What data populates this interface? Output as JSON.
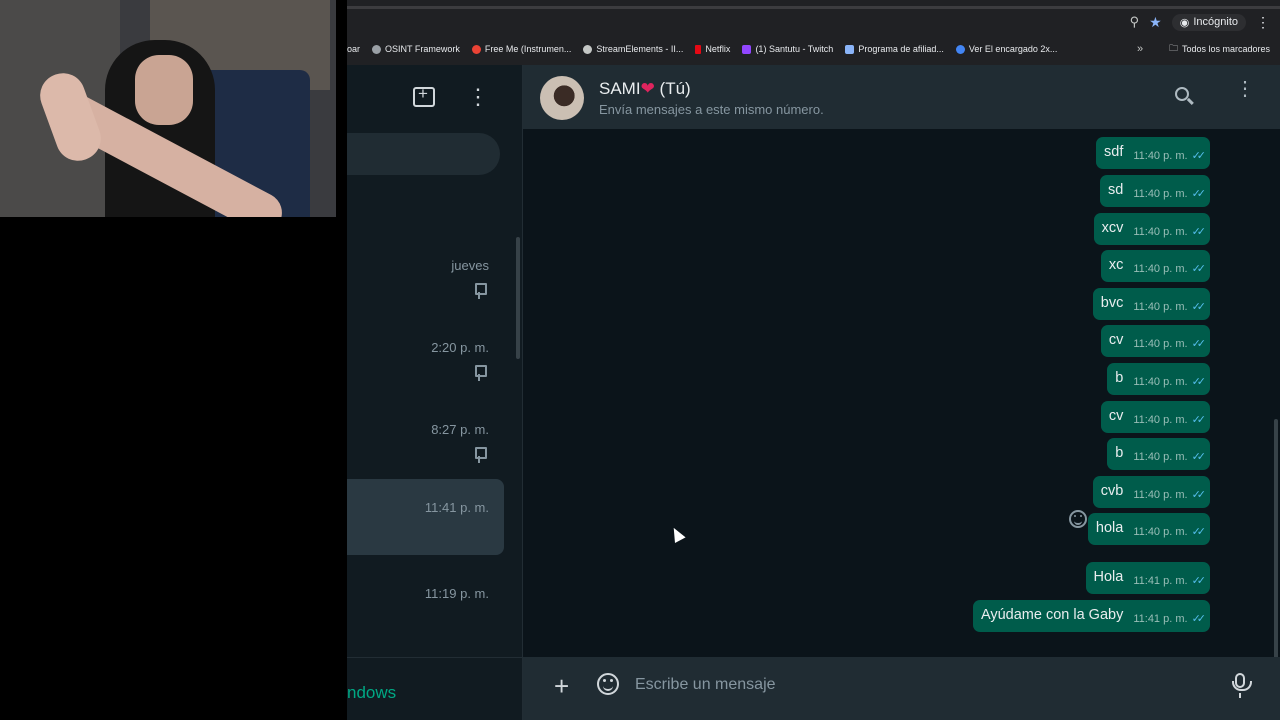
{
  "browser": {
    "incognito_label": "Incógnito",
    "bookmarks": [
      {
        "label": "oar",
        "color": "#5f6368"
      },
      {
        "label": "OSINT Framework",
        "color": "#9aa0a6"
      },
      {
        "label": "Free Me (Instrumen...",
        "color": "#ea4335"
      },
      {
        "label": "StreamElements - II...",
        "color": "#c4c7c5"
      },
      {
        "label": "Netflix",
        "color": "#e50914"
      },
      {
        "label": "(1) Santutu - Twitch",
        "color": "#9146ff"
      },
      {
        "label": "Programa de afiliad...",
        "color": "#8ab4f8"
      },
      {
        "label": "Ver El encargado 2x...",
        "color": "#4285f4"
      }
    ],
    "more_label": "»",
    "all_bookmarks_label": "Todos los marcadores"
  },
  "sidebar": {
    "chats": [
      {
        "time": "jueves",
        "pinned": true
      },
      {
        "time": "2:20 p. m.",
        "pinned": true
      },
      {
        "time": "8:27 p. m.",
        "pinned": true
      },
      {
        "time": "11:41 p. m.",
        "pinned": false,
        "active": true
      },
      {
        "time": "11:19 p. m.",
        "pinned": false
      }
    ],
    "windows_text": "ndows"
  },
  "chat": {
    "name": "SAMI",
    "name_suffix": "(Tú)",
    "subtitle": "Envía mensajes a este mismo número.",
    "messages": [
      {
        "text": "sdf",
        "time": "11:40 p. m."
      },
      {
        "text": "sd",
        "time": "11:40 p. m."
      },
      {
        "text": "xcv",
        "time": "11:40 p. m."
      },
      {
        "text": "xc",
        "time": "11:40 p. m."
      },
      {
        "text": "bvc",
        "time": "11:40 p. m."
      },
      {
        "text": "cv",
        "time": "11:40 p. m."
      },
      {
        "text": "b",
        "time": "11:40 p. m."
      },
      {
        "text": "cv",
        "time": "11:40 p. m."
      },
      {
        "text": "b",
        "time": "11:40 p. m."
      },
      {
        "text": "cvb",
        "time": "11:40 p. m."
      },
      {
        "text": "hola",
        "time": "11:40 p. m."
      },
      {
        "text": "Hola",
        "time": "11:41 p. m."
      },
      {
        "text": "Ayúdame con la Gaby",
        "time": "11:41 p. m."
      }
    ],
    "composer_placeholder": "Escribe un mensaje"
  },
  "colors": {
    "accent": "#00a884",
    "outgoing_bubble": "#005c4b",
    "read_tick": "#53bdeb"
  }
}
